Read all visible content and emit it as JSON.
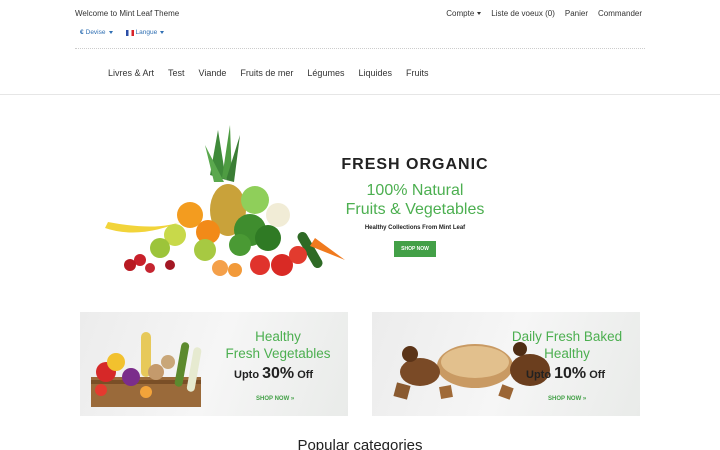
{
  "topbar": {
    "welcome": "Welcome to Mint Leaf Theme",
    "links": [
      "Compte",
      "Liste de voeux (0)",
      "Panier",
      "Commander"
    ],
    "currency": "Devise",
    "language": "Langue"
  },
  "nav": {
    "items": [
      "Livres & Art",
      "Test",
      "Viande",
      "Fruits de mer",
      "Légumes",
      "Liquides",
      "Fruits"
    ]
  },
  "hero": {
    "line1": "FRESH  ORGANIC",
    "line2": "100% Natural",
    "line3": "Fruits & Vegetables",
    "line4": "Healthy Collections From Mint Leaf",
    "button": "SHOP NOW"
  },
  "banners": [
    {
      "title1": "Healthy",
      "title2": "Fresh Vegetables",
      "offer_prefix": "Upto ",
      "offer_value": "30%",
      "offer_suffix": " Off",
      "shop": "SHOP NOW »"
    },
    {
      "title1": "Daily Fresh Baked",
      "title2": "Healthy",
      "offer_prefix": "Upto ",
      "offer_value": "10%",
      "offer_suffix": " Off",
      "shop": "SHOP NOW »"
    }
  ],
  "section": {
    "popular_title": "Popular categories"
  },
  "colors": {
    "accent": "#4caf50",
    "button": "#43a047",
    "link_blue": "#2f6fb3"
  }
}
